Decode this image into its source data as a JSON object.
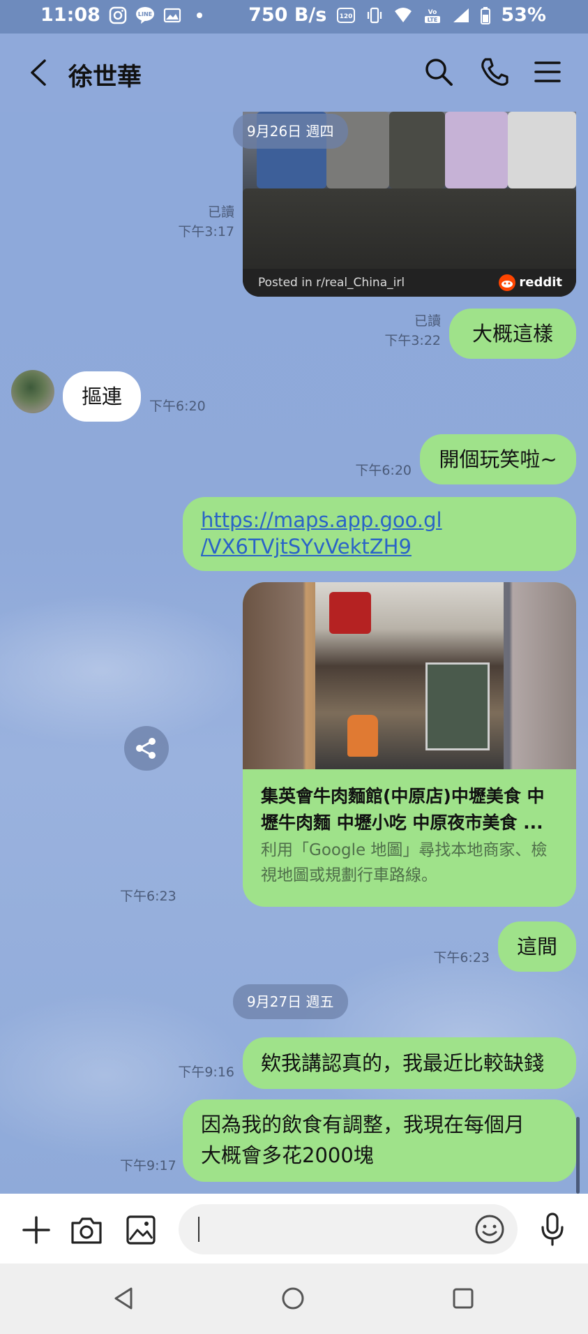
{
  "status_bar": {
    "time": "11:08",
    "net_speed": "750 B/s",
    "battery": "53%",
    "icons": [
      "instagram-icon",
      "line-icon",
      "gallery-icon",
      "dot-icon",
      "hd-voice-icon",
      "vibrate-icon",
      "wifi-icon",
      "volte-icon",
      "signal-icon",
      "battery-icon"
    ]
  },
  "header": {
    "title": "徐世華",
    "icons": [
      "back-icon",
      "search-icon",
      "phone-icon",
      "menu-icon"
    ]
  },
  "dates": [
    "9月26日 週四",
    "9月27日 週五"
  ],
  "messages": [
    {
      "side": "out",
      "type": "image",
      "caption": "Posted in r/real_China_irl",
      "brand": "reddit",
      "read": "已讀",
      "time": "下午3:17"
    },
    {
      "side": "out",
      "type": "text",
      "text": "大概這樣",
      "read": "已讀",
      "time": "下午3:22"
    },
    {
      "side": "in",
      "type": "text",
      "text": "摳連",
      "time": "下午6:20"
    },
    {
      "side": "out",
      "type": "text",
      "text": "開個玩笑啦~",
      "time": "下午6:20"
    },
    {
      "side": "out",
      "type": "link",
      "text_line1": "https://maps.app.goo.gl",
      "text_line2": "/VX6TVjtSYvVektZH9"
    },
    {
      "side": "out",
      "type": "card",
      "title": "集英會牛肉麵館(中原店)中壢美食 中壢牛肉麵 中壢小吃 中原夜市美食 ...",
      "description": "利用「Google 地圖」尋找本地商家、檢視地圖或規劃行車路線。",
      "time": "下午6:23"
    },
    {
      "side": "out",
      "type": "text",
      "text": "這間",
      "time": "下午6:23"
    },
    {
      "side": "out",
      "type": "text",
      "text": "欸我講認真的，我最近比較缺錢",
      "time": "下午9:16"
    },
    {
      "side": "out",
      "type": "text",
      "text_line1": "因為我的飲食有調整，我現在每個月",
      "text_line2": "大概會多花2000塊",
      "time": "下午9:17"
    }
  ],
  "input_bar": {
    "icons": [
      "plus-icon",
      "camera-icon",
      "image-icon",
      "emoji-icon",
      "microphone-icon"
    ],
    "placeholder": ""
  },
  "nav_bar": {
    "icons": [
      "nav-back-icon",
      "nav-home-icon",
      "nav-recents-icon"
    ]
  },
  "colors": {
    "chat_bg": "#8fa9da",
    "out_bubble": "#9fe28a",
    "in_bubble": "#ffffff",
    "status_bar": "#6e8bbd"
  }
}
